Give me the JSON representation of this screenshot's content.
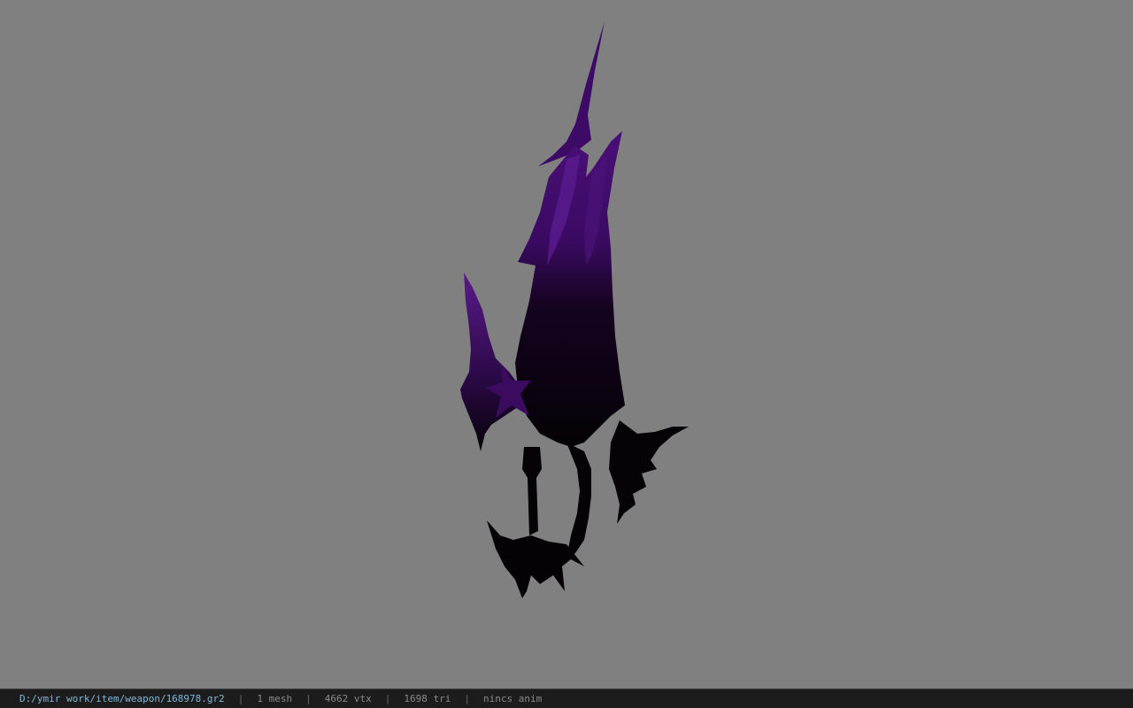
{
  "viewer": {
    "background_color": "#808080",
    "model_colors": {
      "dark": "#050307",
      "purple": "#4a0f78",
      "purple_highlight": "#7a3ab0"
    }
  },
  "status_bar": {
    "file_path": "D:/ymir work/item/weapon/168978.gr2",
    "mesh": "1 mesh",
    "vertices": "4662 vtx",
    "triangles": "1698 tri",
    "animation": "nincs anim",
    "separator": "|"
  }
}
